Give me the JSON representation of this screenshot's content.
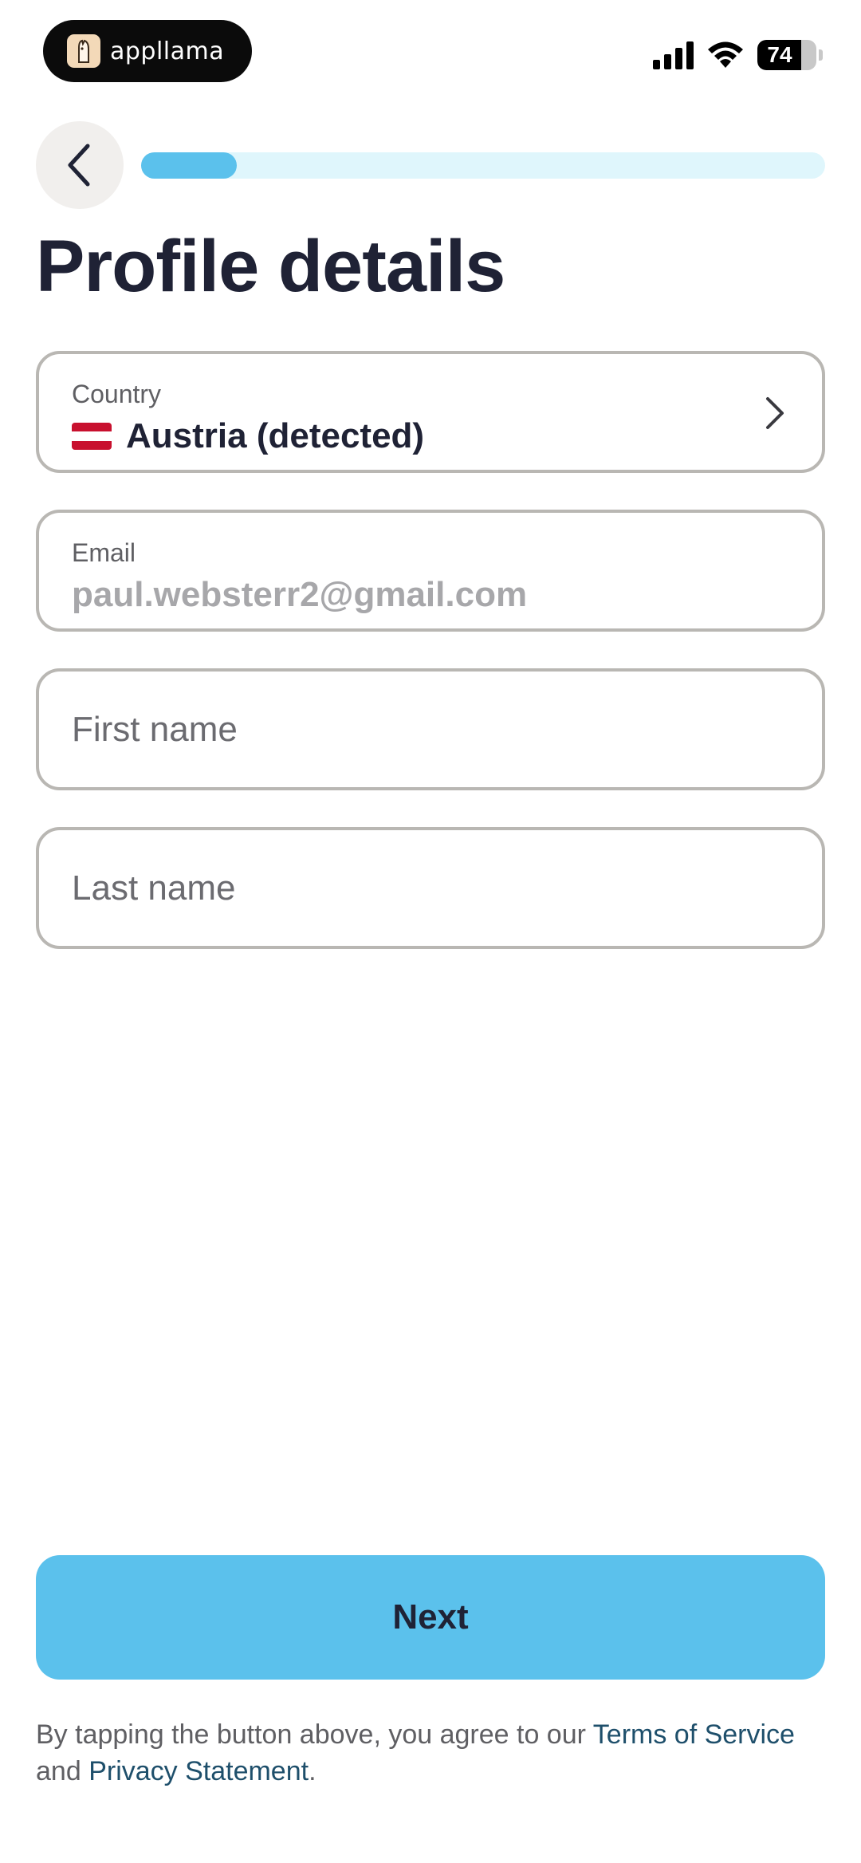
{
  "status_bar": {
    "app_name": "appllama",
    "app_logo_icon": "llama-icon",
    "battery": "74",
    "battery_level": 0.74
  },
  "header": {
    "progress": 0.14,
    "title": "Profile details"
  },
  "form": {
    "country": {
      "label": "Country",
      "value": "Austria (detected)"
    },
    "email": {
      "label": "Email",
      "value": "paul.websterr2@gmail.com"
    },
    "first_name": {
      "placeholder": "First name",
      "value": ""
    },
    "last_name": {
      "placeholder": "Last name",
      "value": ""
    }
  },
  "next_button": {
    "label": "Next"
  },
  "legal": {
    "prefix": "By tapping the button above, you agree to our ",
    "terms": "Terms of Service",
    "middle": " and ",
    "privacy": "Privacy Statement",
    "suffix": "."
  },
  "colors": {
    "accent": "#5bc1ec",
    "progress_track": "#dff6fc",
    "title": "#1f2235",
    "link": "#1e4f6b",
    "flag_red": "#c8102e"
  }
}
